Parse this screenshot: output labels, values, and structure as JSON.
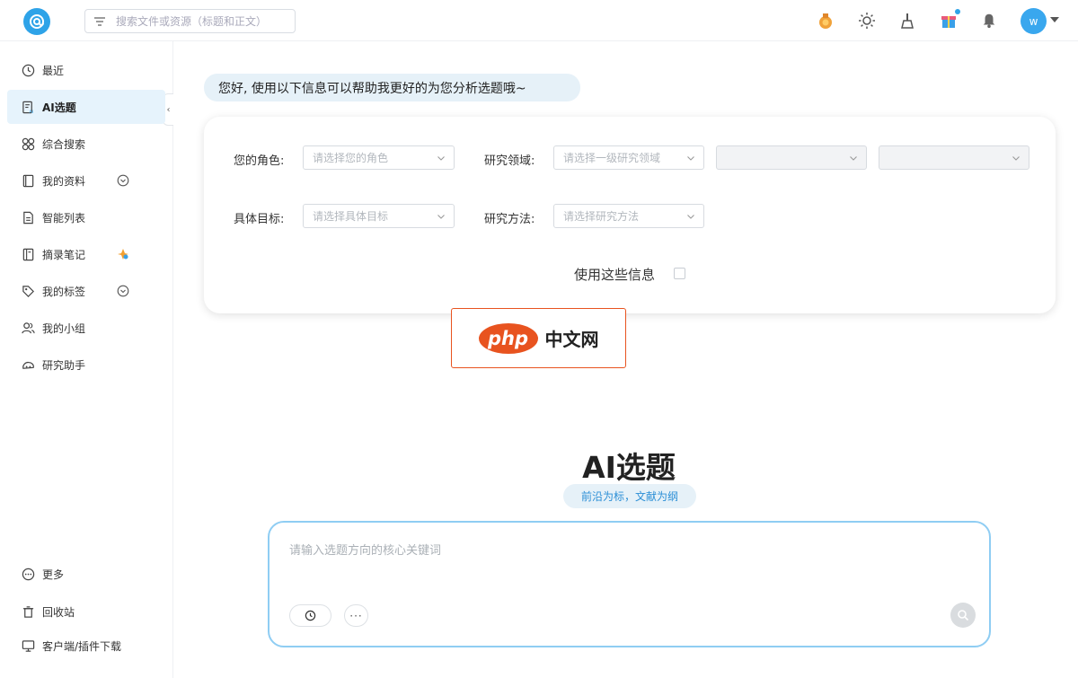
{
  "header": {
    "search_placeholder": "搜索文件或资源（标题和正文）",
    "avatar_letter": "w",
    "accent_color": "#2ea3e8"
  },
  "sidebar": {
    "items": [
      {
        "label": "最近",
        "icon": "clock-icon"
      },
      {
        "label": "AI选题",
        "icon": "ai-doc-icon",
        "active": true
      },
      {
        "label": "综合搜索",
        "icon": "grid-search-icon"
      },
      {
        "label": "我的资料",
        "icon": "book-icon",
        "expandable": true
      },
      {
        "label": "智能列表",
        "icon": "smart-list-icon"
      },
      {
        "label": "摘录笔记",
        "icon": "notebook-icon"
      },
      {
        "label": "我的标签",
        "icon": "tag-icon",
        "expandable": true
      },
      {
        "label": "我的小组",
        "icon": "group-icon"
      },
      {
        "label": "研究助手",
        "icon": "assistant-icon"
      }
    ],
    "bottom": [
      {
        "label": "更多",
        "icon": "more-circle-icon"
      },
      {
        "label": "回收站",
        "icon": "trash-icon"
      },
      {
        "label": "客户端/插件下载",
        "icon": "monitor-icon"
      }
    ]
  },
  "main": {
    "greeting": "您好, 使用以下信息可以帮助我更好的为您分析选题哦~",
    "form": {
      "role_label": "您的角色:",
      "role_placeholder": "请选择您的角色",
      "field_label": "研究领域:",
      "field_placeholder": "请选择一级研究领域",
      "goal_label": "具体目标:",
      "goal_placeholder": "请选择具体目标",
      "method_label": "研究方法:",
      "method_placeholder": "请选择研究方法",
      "use_info_label": "使用这些信息"
    },
    "watermark": {
      "php": "php",
      "cn": "中文网"
    },
    "title": "AI选题",
    "subtitle": "前沿为标，文献为纲",
    "input_placeholder": "请输入选题方向的核心关键词",
    "more_label": "···"
  }
}
